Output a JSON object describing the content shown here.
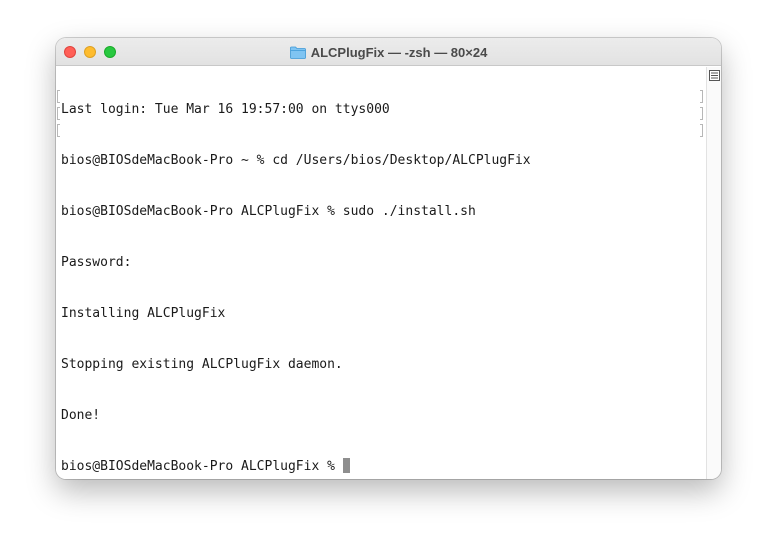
{
  "window": {
    "title": "ALCPlugFix — -zsh — 80×24"
  },
  "terminal": {
    "lines": [
      "Last login: Tue Mar 16 19:57:00 on ttys000",
      "bios@BIOSdeMacBook-Pro ~ % cd /Users/bios/Desktop/ALCPlugFix",
      "bios@BIOSdeMacBook-Pro ALCPlugFix % sudo ./install.sh",
      "Password:",
      "Installing ALCPlugFix",
      "Stopping existing ALCPlugFix daemon.",
      "Done!",
      "bios@BIOSdeMacBook-Pro ALCPlugFix % "
    ]
  },
  "icons": {
    "title": "folder-icon",
    "scrollbar": "inspector-icon"
  },
  "colors": {
    "close": "#ff5f57",
    "minimize": "#febc2e",
    "zoom": "#28c840",
    "folder": "#5eb1ea"
  }
}
